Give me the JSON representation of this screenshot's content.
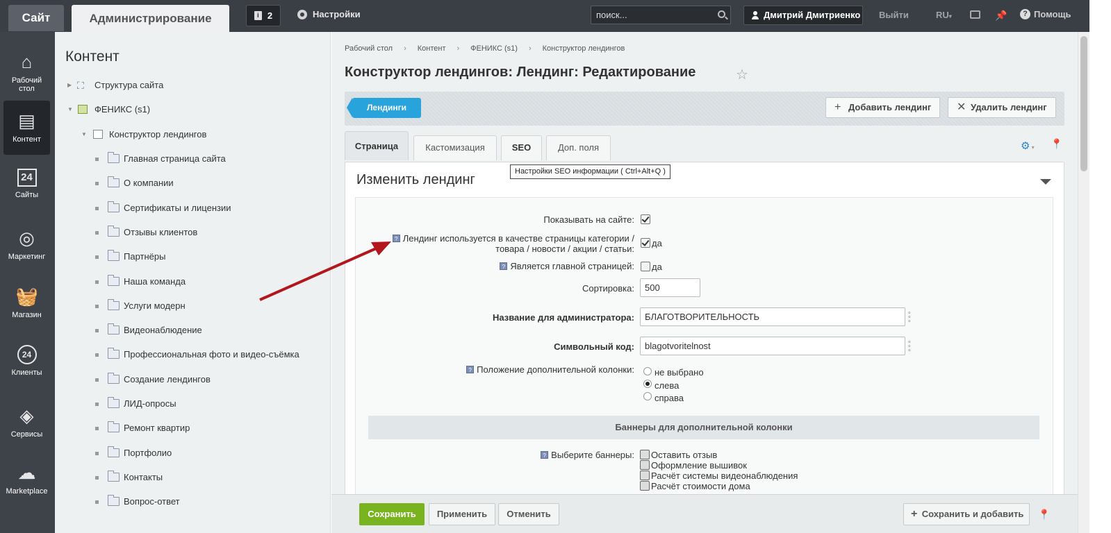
{
  "topbar": {
    "site_tab": "Сайт",
    "admin_tab": "Администрирование",
    "notifications_count": "2",
    "settings": "Настройки",
    "search_placeholder": "поиск...",
    "user": "Дмитрий Дмитриенко",
    "logout": "Выйти",
    "lang": "RU",
    "help": "Помощь"
  },
  "sidebar": {
    "items": [
      {
        "label": "Рабочий стол"
      },
      {
        "label": "Контент"
      },
      {
        "label": "Сайты"
      },
      {
        "label": "Маркетинг"
      },
      {
        "label": "Магазин"
      },
      {
        "label": "Клиенты"
      },
      {
        "label": "Сервисы"
      },
      {
        "label": "Marketplace"
      }
    ],
    "sites_badge": "24",
    "clients_badge": "24"
  },
  "tree": {
    "title": "Контент",
    "items": [
      {
        "label": "Структура сайта"
      },
      {
        "label": "ФЕНИКС (s1)"
      },
      {
        "label": "Конструктор лендингов"
      },
      {
        "label": "Главная страница сайта"
      },
      {
        "label": "О компании"
      },
      {
        "label": "Сертификаты и лицензии"
      },
      {
        "label": "Отзывы клиентов"
      },
      {
        "label": "Партнёры"
      },
      {
        "label": "Наша команда"
      },
      {
        "label": "Услуги модерн"
      },
      {
        "label": "Видеонаблюдение"
      },
      {
        "label": "Профессиональная фото и видео-съёмка"
      },
      {
        "label": "Создание лендингов"
      },
      {
        "label": "ЛИД-опросы"
      },
      {
        "label": "Ремонт квартир"
      },
      {
        "label": "Портфолио"
      },
      {
        "label": "Контакты"
      },
      {
        "label": "Вопрос-ответ"
      }
    ]
  },
  "breadcrumb": [
    "Рабочий стол",
    "Контент",
    "ФЕНИКС (s1)",
    "Конструктор лендингов"
  ],
  "page_title": "Конструктор лендингов: Лендинг: Редактирование",
  "toolbar": {
    "landings": "Лендинги",
    "add": "Добавить лендинг",
    "delete": "Удалить лендинг"
  },
  "tabs": [
    "Страница",
    "Кастомизация",
    "SEO",
    "Доп. поля"
  ],
  "tooltip": "Настройки SEO информации ( Ctrl+Alt+Q )",
  "form": {
    "heading": "Изменить лендинг",
    "show_on_site": "Показывать на сайте:",
    "used_as_page_line1": "Лендинг используется в качестве страницы категории /",
    "used_as_page_line2": "товара / новости / акции / статьи:",
    "yes": "да",
    "is_main": "Является главной страницей:",
    "sort_label": "Сортировка:",
    "sort_value": "500",
    "admin_name_label": "Название для администратора:",
    "admin_name_value": "БЛАГОТВОРИТЕЛЬНОСТЬ",
    "code_label": "Символьный код:",
    "code_value": "blagotvoritelnost",
    "column_label": "Положение дополнительной колонки:",
    "column_options": [
      "не выбрано",
      "слева",
      "справа"
    ],
    "banners_section": "Баннеры для дополнительной колонки",
    "banners_label": "Выберите баннеры:",
    "banners": [
      "Оставить отзыв",
      "Оформление вышивок",
      "Расчёт системы видеонаблюдения",
      "Расчёт стоимости дома"
    ]
  },
  "bottom": {
    "save": "Сохранить",
    "apply": "Применить",
    "cancel": "Отменить",
    "save_add": "Сохранить и добавить"
  },
  "colors": {
    "topbar": "#3a3f45",
    "accent_blue": "#29a3dc",
    "save_green": "#7ab320",
    "arrow_red": "#b3161b"
  }
}
